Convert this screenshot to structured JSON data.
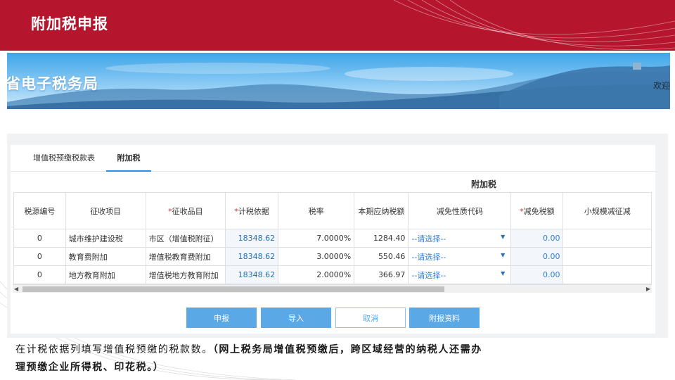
{
  "slide": {
    "title": "附加税申报",
    "caption_plain": "在计税依据列填写增值税预缴的税款数。",
    "caption_bold_1": "（网上税务局增值税预缴后，跨区域经营的纳税人还需办",
    "caption_bold_2": "理预缴企业所得税、印花税。）"
  },
  "banner": {
    "title": "省电子税务局",
    "welcome": "欢迎"
  },
  "tabs": [
    {
      "label": "增值税预缴税款表",
      "active": false
    },
    {
      "label": "附加税",
      "active": true
    }
  ],
  "table": {
    "group_header": "附加税",
    "columns": [
      {
        "label": "税源编号",
        "required": false
      },
      {
        "label": "征收项目",
        "required": false
      },
      {
        "label": "征收品目",
        "required": true
      },
      {
        "label": "计税依据",
        "required": true
      },
      {
        "label": "税率",
        "required": false
      },
      {
        "label": "本期应纳税额",
        "required": false
      },
      {
        "label": "减免性质代码",
        "required": false
      },
      {
        "label": "减免税额",
        "required": true
      },
      {
        "label": "小规模减征减",
        "required": false
      }
    ],
    "rows": [
      {
        "source_no": "0",
        "item": "城市维护建设税",
        "sub_item": "市区（增值税附征）",
        "basis": "18348.62",
        "rate": "7.0000%",
        "tax": "1284.40",
        "relief_code": "--请选择--",
        "relief_amount": "0.00"
      },
      {
        "source_no": "0",
        "item": "教育费附加",
        "sub_item": "增值税教育费附加",
        "basis": "18348.62",
        "rate": "3.0000%",
        "tax": "550.46",
        "relief_code": "--请选择--",
        "relief_amount": "0.00"
      },
      {
        "source_no": "0",
        "item": "地方教育附加",
        "sub_item": "增值税地方教育附加",
        "basis": "18348.62",
        "rate": "2.0000%",
        "tax": "366.97",
        "relief_code": "--请选择--",
        "relief_amount": "0.00"
      }
    ]
  },
  "buttons": {
    "submit": "申报",
    "import": "导入",
    "cancel": "取消",
    "attach": "附报资料"
  },
  "colors": {
    "title_bar": "#b5162d",
    "accent_blue": "#5aa8e6",
    "link_blue": "#1f6fb8"
  },
  "icons": {
    "dropdown": "caret-down-icon",
    "scroll_left": "triangle-left-icon",
    "scroll_right": "triangle-right-icon"
  }
}
